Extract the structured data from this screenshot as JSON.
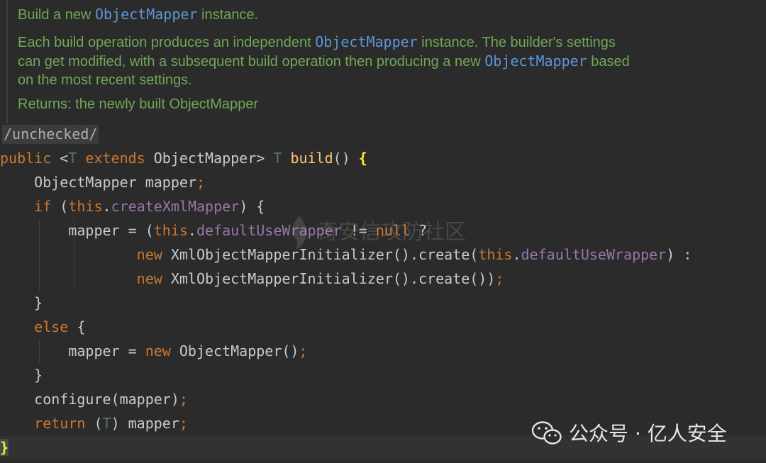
{
  "doc": {
    "line1_pre": "Build a new ",
    "line1_cls": "ObjectMapper",
    "line1_post": " instance.",
    "para_a_pre": "Each build operation produces an independent ",
    "para_a_cls": "ObjectMapper",
    "para_a_post": " instance. The builder's settings",
    "para_b_pre": "can get modified, with a subsequent build operation then producing a new ",
    "para_b_cls": "ObjectMapper",
    "para_b_post": " based",
    "para_c": "on the most recent settings.",
    "returns": "Returns: the newly built ObjectMapper"
  },
  "annotation": "/unchecked/",
  "code": {
    "l1": {
      "kw_public": "public",
      "lt": " <",
      "t1": "T",
      "kw_extends": " extends",
      "om": " ObjectMapper> ",
      "t2": "T",
      "sp": " ",
      "fn": "build",
      "paren": "() ",
      "brace": "{"
    },
    "l2": {
      "decl": "    ObjectMapper mapper",
      "semi": ";"
    },
    "l3": {
      "indent": "    ",
      "kw_if": "if",
      "open": " (",
      "kw_this": "this",
      "dot": ".",
      "field": "createXmlMapper",
      "close": ") {"
    },
    "l4": {
      "pre": "        mapper = (",
      "kw_this": "this",
      "dot": ".",
      "field": "defaultUseWrapper",
      "op": " != ",
      "kw_null": "null",
      "q": " ?"
    },
    "l5": {
      "indent": "                ",
      "kw_new": "new",
      "call": " XmlObjectMapperInitializer().create(",
      "kw_this": "this",
      "dot": ".",
      "field": "defaultUseWrapper",
      "end": ") :"
    },
    "l6": {
      "indent": "                ",
      "kw_new": "new",
      "call": " XmlObjectMapperInitializer().create())",
      "semi": ";"
    },
    "l7": {
      "text": "    }"
    },
    "l8": {
      "indent": "    ",
      "kw_else": "else",
      "rest": " {"
    },
    "l9": {
      "pre": "        mapper = ",
      "kw_new": "new",
      "call": " ObjectMapper()",
      "semi": ";"
    },
    "l10": {
      "text": "    }"
    },
    "l11": {
      "call": "    configure(mapper)",
      "semi": ";"
    },
    "l12": {
      "indent": "    ",
      "kw_return": "return",
      "open": " (",
      "t": "T",
      "rest": ") mapper",
      "semi": ";"
    },
    "l13": {
      "brace": "}"
    }
  },
  "watermark": "奇安信攻防社区",
  "brand": "公众号 · 亿人安全",
  "colors": {
    "background": "#2b2b2b",
    "keyword": "#cb7832",
    "doc": "#6fa857",
    "field": "#9876aa",
    "method": "#ffc66d"
  }
}
